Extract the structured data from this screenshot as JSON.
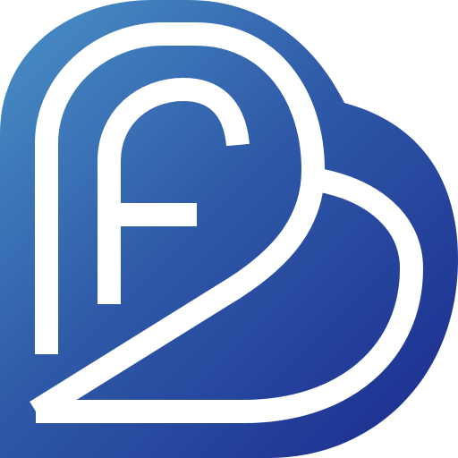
{
  "logo": {
    "icon_name": "f2-heart-logo-icon",
    "colors": {
      "gradient_start": "#4a92c8",
      "gradient_mid": "#2f5aa8",
      "gradient_end": "#1a2a8e",
      "stroke": "#ffffff",
      "background": "#ffffff"
    }
  }
}
